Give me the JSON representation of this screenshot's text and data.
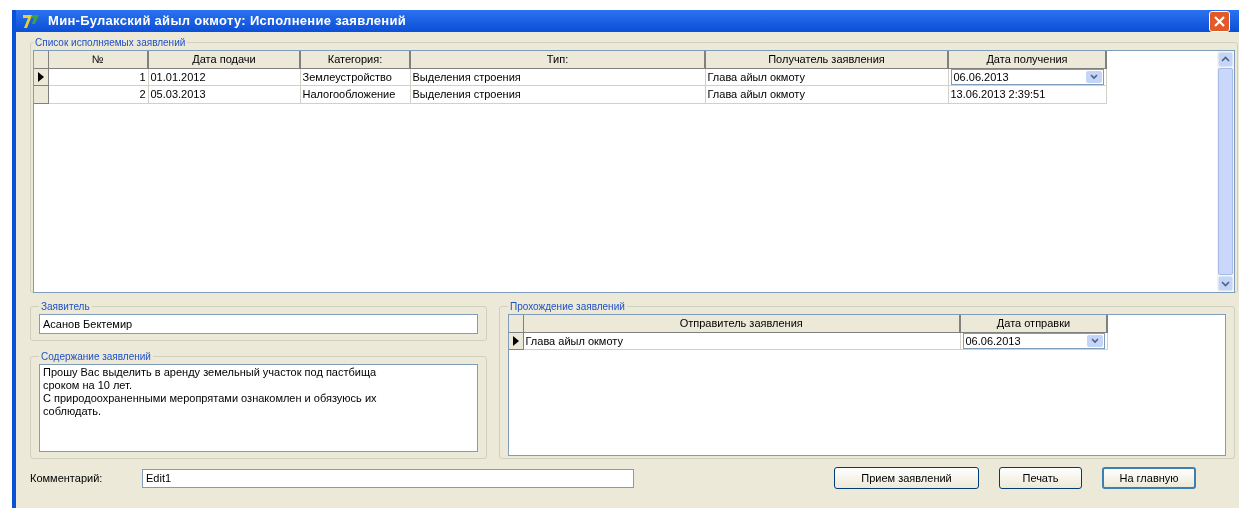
{
  "window": {
    "title": "Мин-Булакский айыл окмоту: Исполнение заявлений"
  },
  "applications": {
    "caption": "Список исполняемых заявлений",
    "columns": [
      "№",
      "Дата подачи",
      "Категория:",
      "Тип:",
      "Получатель заявления",
      "Дата получения"
    ],
    "rows": [
      {
        "selected": true,
        "editing_last": true,
        "cells": [
          "1",
          "01.01.2012",
          "Землеустройство",
          "Выделения строения",
          "Глава айыл окмоту",
          "06.06.2013"
        ]
      },
      {
        "selected": false,
        "editing_last": false,
        "cells": [
          "2",
          "05.03.2013",
          "Налогообложение",
          "Выделения строения",
          "Глава айыл окмоту",
          "13.06.2013 2:39:51"
        ]
      }
    ]
  },
  "applicant": {
    "caption": "Заявитель",
    "value": "Асанов Бектемир"
  },
  "content": {
    "caption": "Содержание заявлений",
    "lines": [
      "Прошу Вас выделить в аренду земельный участок под пастбища сроком на 10 лет.",
      "С природоохраненными меропрятами ознакомлен и обязуюсь их соблюдать."
    ]
  },
  "routing": {
    "caption": "Прохождение заявлений",
    "columns": [
      "Отправитель заявления",
      "Дата отправки"
    ],
    "rows": [
      {
        "selected": true,
        "editing_last": true,
        "cells": [
          "Глава айыл окмоту",
          "06.06.2013"
        ]
      }
    ]
  },
  "comment": {
    "label": "Комментарий:",
    "value": "Edit1"
  },
  "buttons": [
    {
      "label": "Прием заявлений",
      "default": false
    },
    {
      "label": "Печать",
      "default": false
    },
    {
      "label": "На главную",
      "default": true
    }
  ]
}
